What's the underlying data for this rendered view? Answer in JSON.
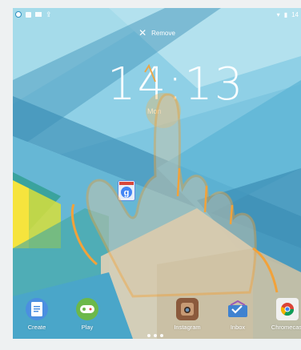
{
  "status_bar": {
    "time": "14"
  },
  "remove": {
    "label": "Remove"
  },
  "lockscreen": {
    "time": "14:13",
    "date_partial": "Mon"
  },
  "folder": {
    "icon": "google-search-icon"
  },
  "dock": {
    "items": [
      {
        "label": "Create",
        "icon": "docs-icon"
      },
      {
        "label": "Play",
        "icon": "play-games-icon"
      },
      {
        "label": "Instagram",
        "icon": "instagram-icon"
      },
      {
        "label": "Inbox",
        "icon": "inbox-icon"
      },
      {
        "label": "Chromecast",
        "icon": "chromecast-icon"
      }
    ]
  },
  "colors": {
    "wallpaper_light": "#9dd6e6",
    "wallpaper_mid": "#5fb5d6",
    "wallpaper_dark": "#2f8fb8",
    "wallpaper_teal": "#3fa6a2",
    "wallpaper_yellow": "#f6e43d",
    "wallpaper_beige": "#d9cfb6",
    "hand_outline": "#f2a23a"
  }
}
